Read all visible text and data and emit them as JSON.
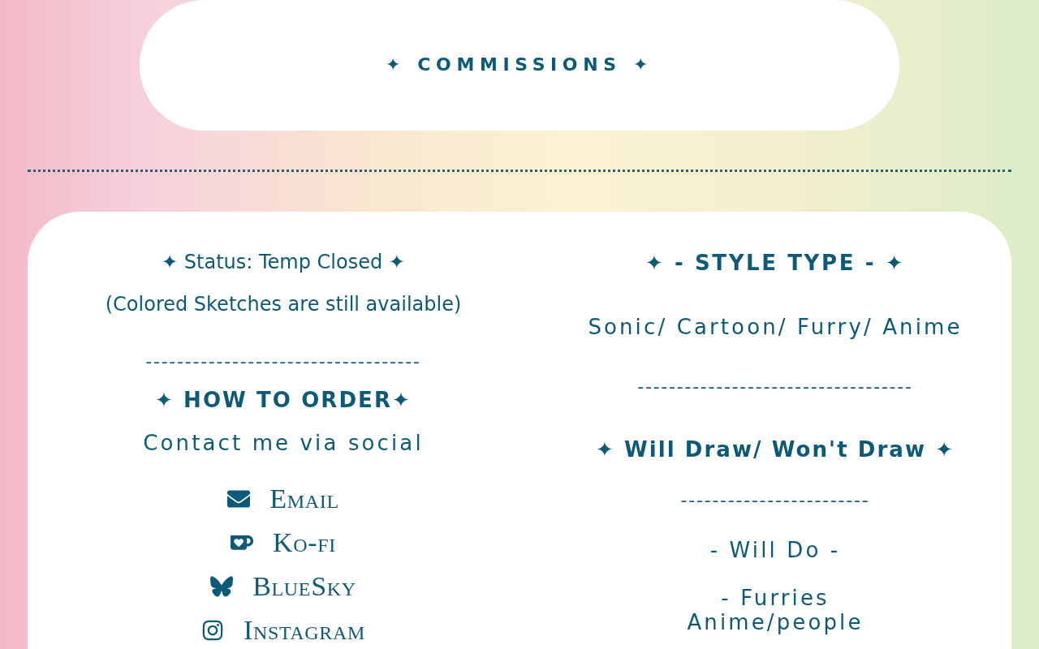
{
  "header": {
    "title": "✦ COMMISSIONS ✦"
  },
  "left": {
    "status": "✦ Status: Temp Closed ✦",
    "note": "(Colored Sketches are still available)",
    "divider": "-----------------------------------",
    "heading": "✦ HOW TO ORDER✦",
    "contact": "Contact me via social",
    "links": [
      {
        "kind": "email",
        "label": "Email"
      },
      {
        "kind": "kofi",
        "label": "Ko-fi"
      },
      {
        "kind": "bluesky",
        "label": "BlueSky"
      },
      {
        "kind": "instagram",
        "label": "Instagram"
      }
    ]
  },
  "right": {
    "heading": "✦ - STYLE TYPE - ✦",
    "styles": "Sonic/ Cartoon/ Furry/ Anime",
    "divider": "-----------------------------------",
    "subheading": "✦ Will Draw/ Won't Draw ✦",
    "divider2": "------------------------",
    "will_do": "- Will Do -",
    "items": [
      "- Furries",
      "Anime/people"
    ]
  }
}
